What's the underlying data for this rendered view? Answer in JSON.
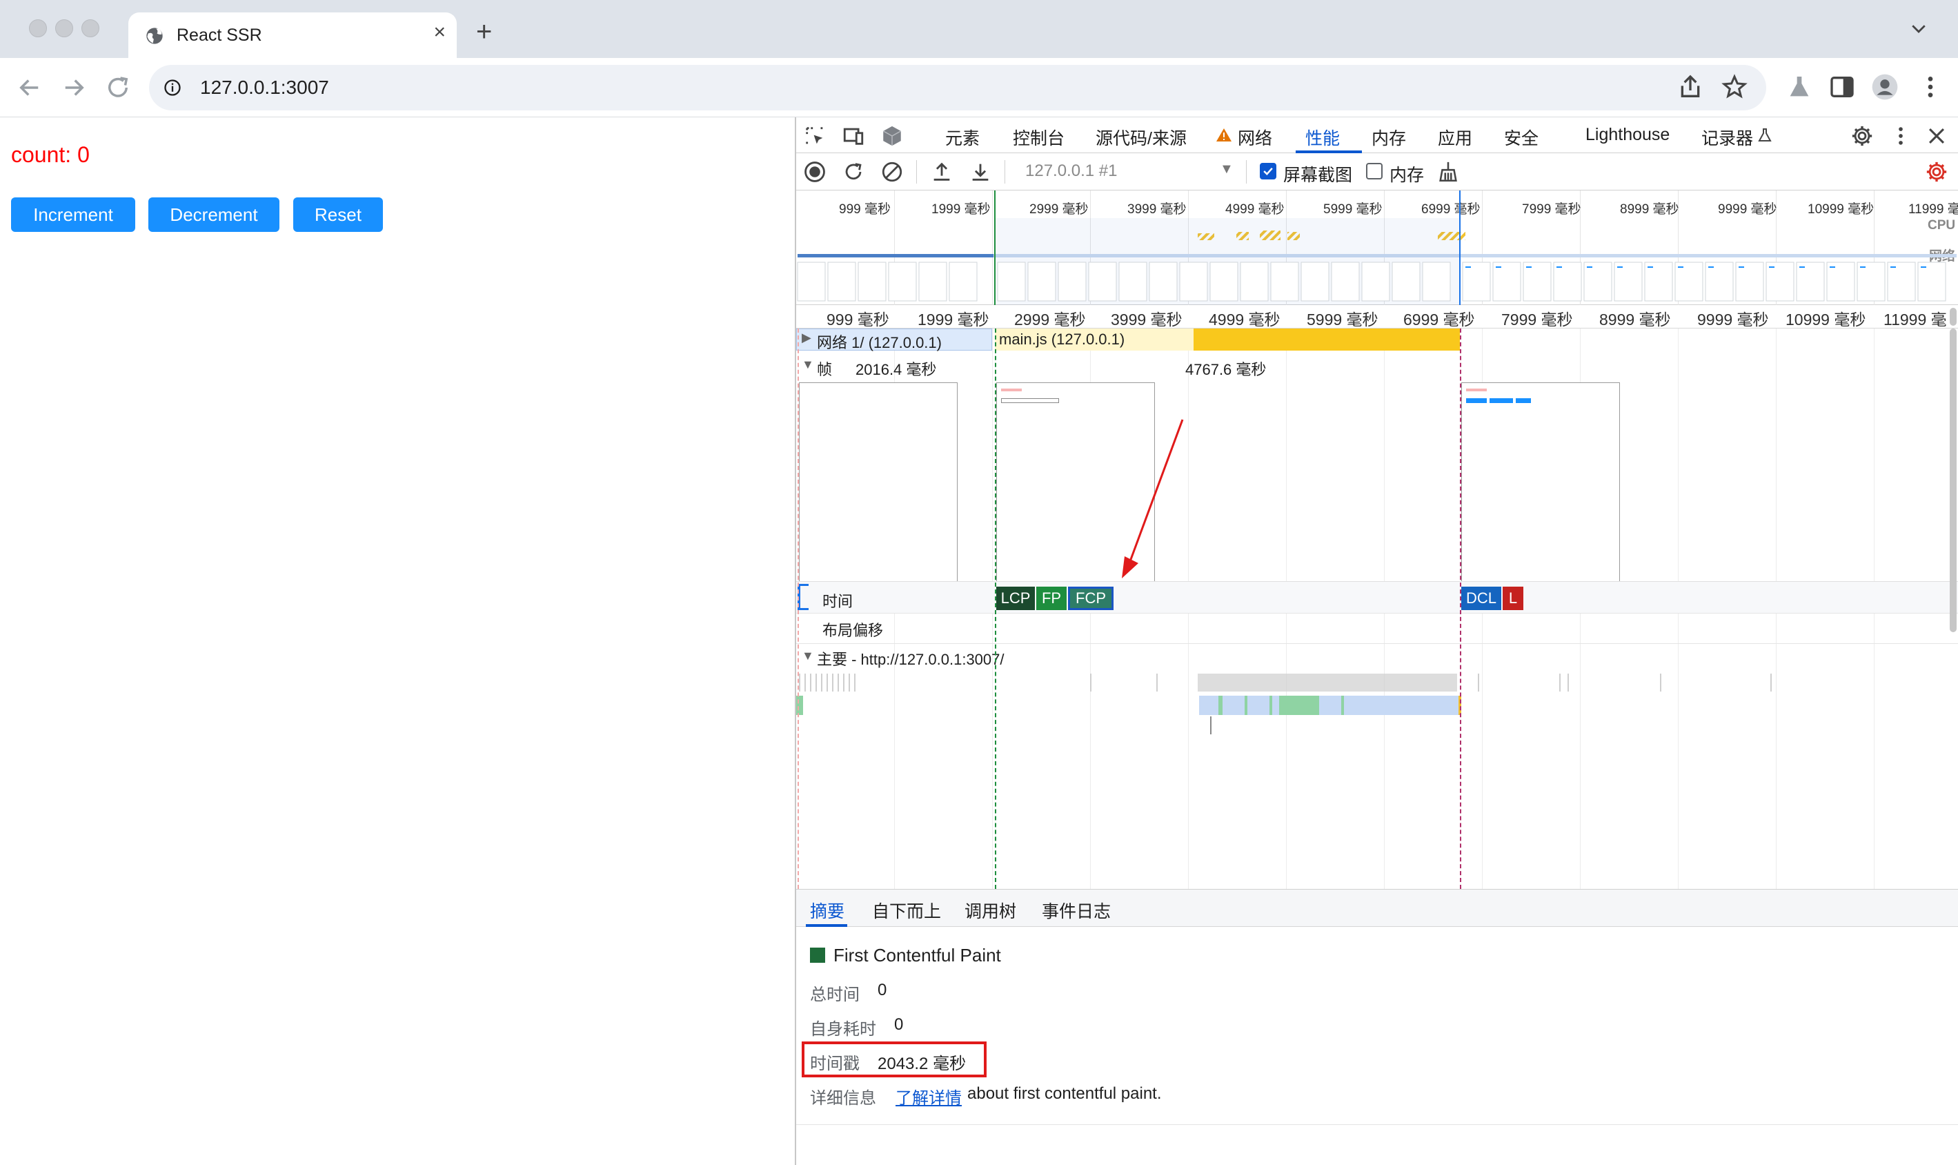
{
  "browser": {
    "tab_title": "React SSR",
    "tab_close": "×",
    "new_tab": "+",
    "url": "127.0.0.1:3007"
  },
  "page": {
    "count_text": "count: 0",
    "buttons": [
      "Increment",
      "Decrement",
      "Reset"
    ]
  },
  "devtools": {
    "tabs": [
      "元素",
      "控制台",
      "源代码/来源",
      "网络",
      "性能",
      "内存",
      "应用",
      "安全",
      "Lighthouse",
      "记录器"
    ],
    "active_tab": "性能",
    "profile_select": "127.0.0.1 #1",
    "screenshot_checkbox_label": "屏幕截图",
    "screenshot_checked": true,
    "memory_checkbox_label": "内存",
    "memory_checked": false,
    "overview": {
      "ticks": [
        "999 毫秒",
        "1999 毫秒",
        "2999 毫秒",
        "3999 毫秒",
        "4999 毫秒",
        "5999 毫秒",
        "6999 毫秒",
        "7999 毫秒",
        "8999 毫秒",
        "9999 毫秒",
        "10999 毫秒",
        "11999 毫"
      ],
      "cpu_label": "CPU",
      "network_label": "网络"
    },
    "ruler_ticks": [
      "999 毫秒",
      "1999 毫秒",
      "2999 毫秒",
      "3999 毫秒",
      "4999 毫秒",
      "5999 毫秒",
      "6999 毫秒",
      "7999 毫秒",
      "8999 毫秒",
      "9999 毫秒",
      "10999 毫秒",
      "11999 毫"
    ],
    "tracks": {
      "network_label": "网络 1/ (127.0.0.1)",
      "network_request": "main.js (127.0.0.1)",
      "frames_label": "帧",
      "frame_time_1": "2016.4 毫秒",
      "frame_time_2": "4767.6 毫秒",
      "timings_label": "时间",
      "layout_shift_label": "布局偏移",
      "main_label": "主要 - http://127.0.0.1:3007/"
    },
    "markers": [
      {
        "label": "LCP",
        "color": "#1b4a2e"
      },
      {
        "label": "FP",
        "color": "#1e8e3e"
      },
      {
        "label": "FCP",
        "color": "#2e7d67"
      },
      {
        "label": "DCL",
        "color": "#1565c0"
      },
      {
        "label": "L",
        "color": "#c5221f"
      }
    ],
    "bottom_tabs": [
      "摘要",
      "自下而上",
      "调用树",
      "事件日志"
    ],
    "summary": {
      "title": "First Contentful Paint",
      "total_time_key": "总时间",
      "total_time_val": "0",
      "self_time_key": "自身耗时",
      "self_time_val": "0",
      "timestamp_key": "时间戳",
      "timestamp_val": "2043.2 毫秒",
      "details_key": "详细信息",
      "details_link": "了解详情",
      "details_text": "about first contentful paint."
    }
  }
}
